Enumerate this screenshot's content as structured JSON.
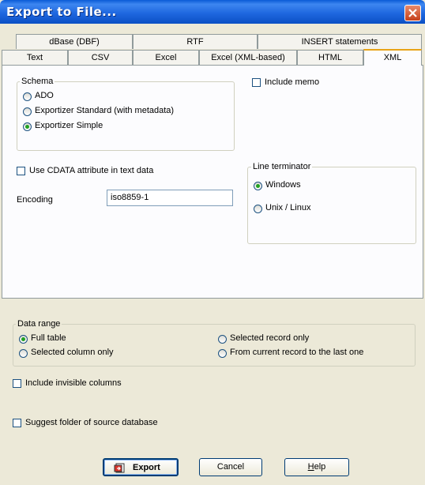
{
  "window": {
    "title": "Export to File..."
  },
  "tabs": {
    "row1": [
      "dBase (DBF)",
      "RTF",
      "INSERT statements"
    ],
    "row2": [
      "Text",
      "CSV",
      "Excel",
      "Excel (XML-based)",
      "HTML",
      "XML"
    ],
    "active": "XML"
  },
  "schema": {
    "legend": "Schema",
    "options": [
      "ADO",
      "Exportizer Standard (with metadata)",
      "Exportizer Simple"
    ],
    "selected": "Exportizer Simple"
  },
  "include_memo": {
    "label": "Include memo",
    "checked": false
  },
  "cdata": {
    "label": "Use CDATA attribute in text data",
    "checked": false
  },
  "encoding": {
    "label": "Encoding",
    "value": "iso8859-1"
  },
  "line_terminator": {
    "legend": "Line terminator",
    "options": [
      "Windows",
      "Unix / Linux"
    ],
    "selected": "Windows"
  },
  "data_range": {
    "legend": "Data range",
    "options": [
      "Full table",
      "Selected column only",
      "Selected record only",
      "From current record to the last one"
    ],
    "selected": "Full table"
  },
  "include_invisible": {
    "label": "Include invisible columns",
    "checked": false
  },
  "suggest_folder": {
    "label": "Suggest folder of source database",
    "checked": false
  },
  "buttons": {
    "export": "Export",
    "cancel": "Cancel",
    "help_first": "H",
    "help_rest": "elp"
  },
  "colors": {
    "title_bar": "#1f68e0",
    "dialog_bg": "#ece9d8",
    "active_tab_accent": "#e8a317"
  }
}
